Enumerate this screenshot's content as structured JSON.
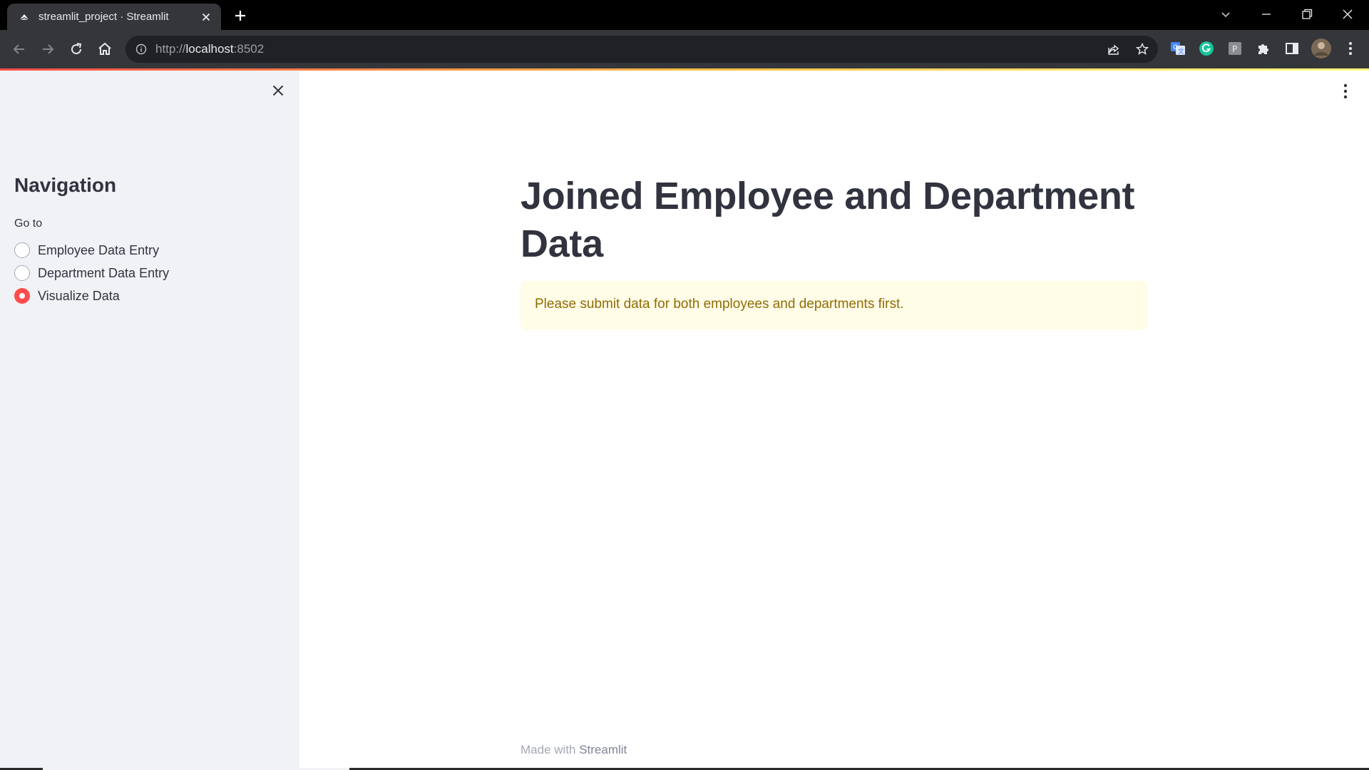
{
  "browser": {
    "tab_title": "streamlit_project · Streamlit",
    "url_scheme": "http://",
    "url_host": "localhost",
    "url_port": ":8502"
  },
  "sidebar": {
    "title": "Navigation",
    "radio_label": "Go to",
    "options": [
      {
        "label": "Employee Data Entry",
        "selected": false
      },
      {
        "label": "Department Data Entry",
        "selected": false
      },
      {
        "label": "Visualize Data",
        "selected": true
      }
    ]
  },
  "main": {
    "title": "Joined Employee and Department Data",
    "warning": "Please submit data for both employees and departments first."
  },
  "footer": {
    "prefix": "Made with ",
    "brand": "Streamlit"
  },
  "colors": {
    "accent": "#ff4b4b",
    "sidebar_bg": "#f0f2f6",
    "warning_bg": "#fffce7",
    "warning_text": "#926c05",
    "text": "#31333f"
  },
  "icons": [
    "streamlit-favicon-icon",
    "tab-close-icon",
    "new-tab-icon",
    "tab-search-icon",
    "minimize-icon",
    "restore-icon",
    "window-close-icon",
    "back-icon",
    "forward-icon",
    "reload-icon",
    "home-icon",
    "site-info-icon",
    "share-icon",
    "bookmark-star-icon",
    "translate-extension-icon",
    "grammarly-extension-icon",
    "p-extension-icon",
    "extensions-puzzle-icon",
    "side-panel-icon",
    "profile-avatar-icon",
    "chrome-menu-icon",
    "sidebar-close-icon",
    "main-menu-icon"
  ]
}
